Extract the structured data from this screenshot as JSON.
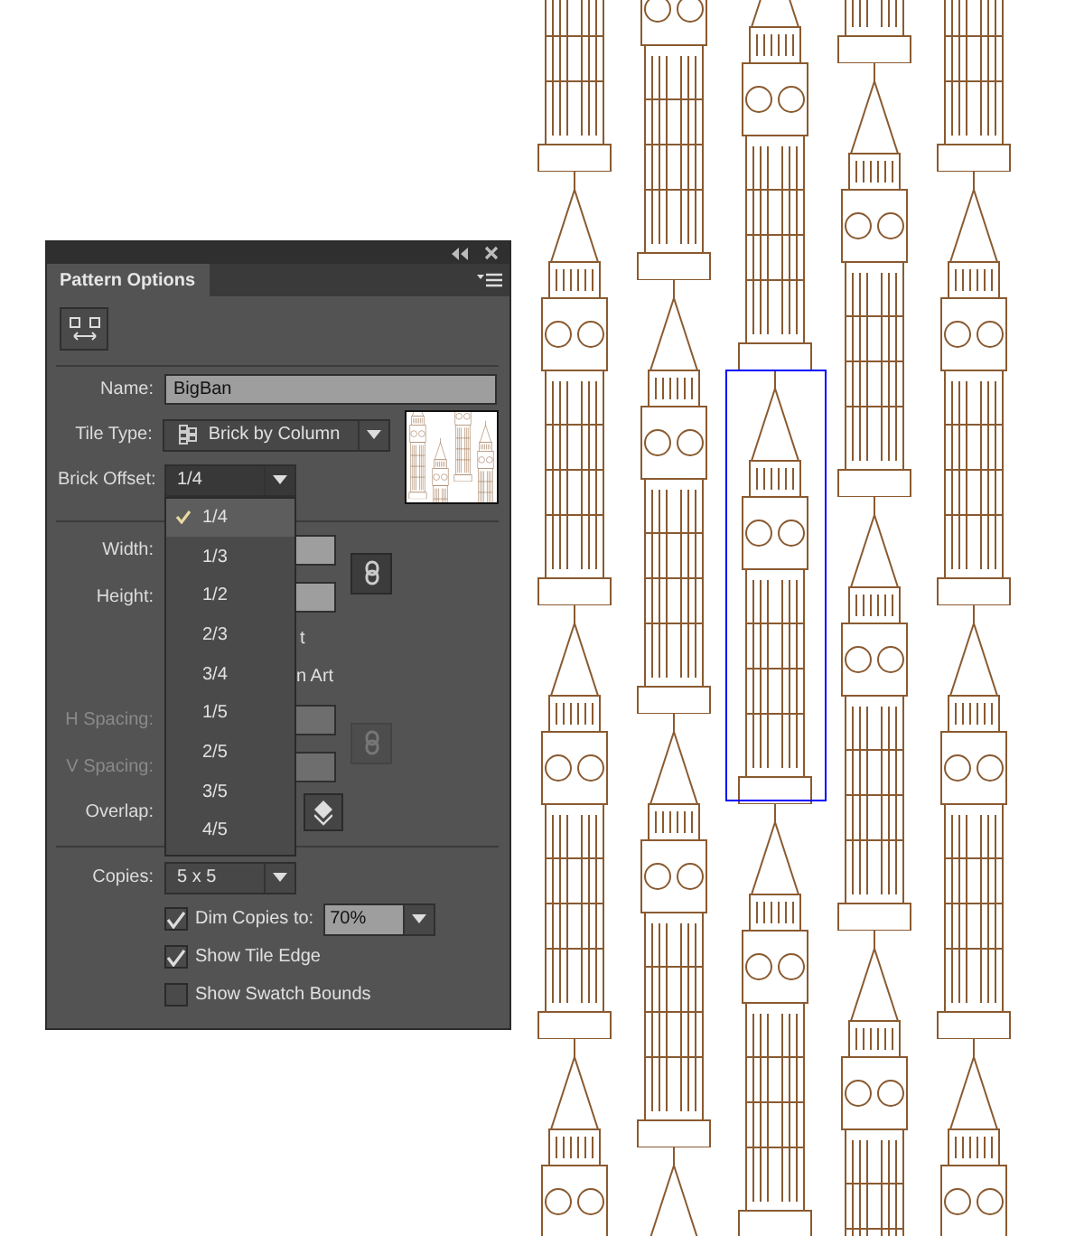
{
  "panel": {
    "title": "Pattern Options",
    "name": {
      "label": "Name:",
      "value": "BigBan"
    },
    "tile_type": {
      "label": "Tile Type:",
      "value": "Brick by Column"
    },
    "brick_offset": {
      "label": "Brick Offset:",
      "value": "1/4",
      "expanded": true,
      "options": [
        {
          "label": "1/4",
          "selected": true
        },
        {
          "label": "1/3",
          "selected": false
        },
        {
          "label": "1/2",
          "selected": false
        },
        {
          "label": "2/3",
          "selected": false
        },
        {
          "label": "3/4",
          "selected": false
        },
        {
          "label": "1/5",
          "selected": false
        },
        {
          "label": "2/5",
          "selected": false
        },
        {
          "label": "3/5",
          "selected": false
        },
        {
          "label": "4/5",
          "selected": false
        }
      ]
    },
    "width": {
      "label": "Width:"
    },
    "height": {
      "label": "Height:"
    },
    "size_tile_to_art": {
      "label": "t"
    },
    "move_tile_with_art": {
      "label": "n Art"
    },
    "h_spacing": {
      "label": "H Spacing:",
      "disabled": true
    },
    "v_spacing": {
      "label": "V Spacing:",
      "disabled": true
    },
    "overlap": {
      "label": "Overlap:"
    },
    "copies": {
      "label": "Copies:",
      "value": "5 x 5"
    },
    "checks": [
      {
        "label": "Dim Copies to:",
        "checked": true,
        "value": "70%"
      },
      {
        "label": "Show Tile Edge",
        "checked": true
      },
      {
        "label": "Show Swatch Bounds",
        "checked": false
      }
    ]
  }
}
